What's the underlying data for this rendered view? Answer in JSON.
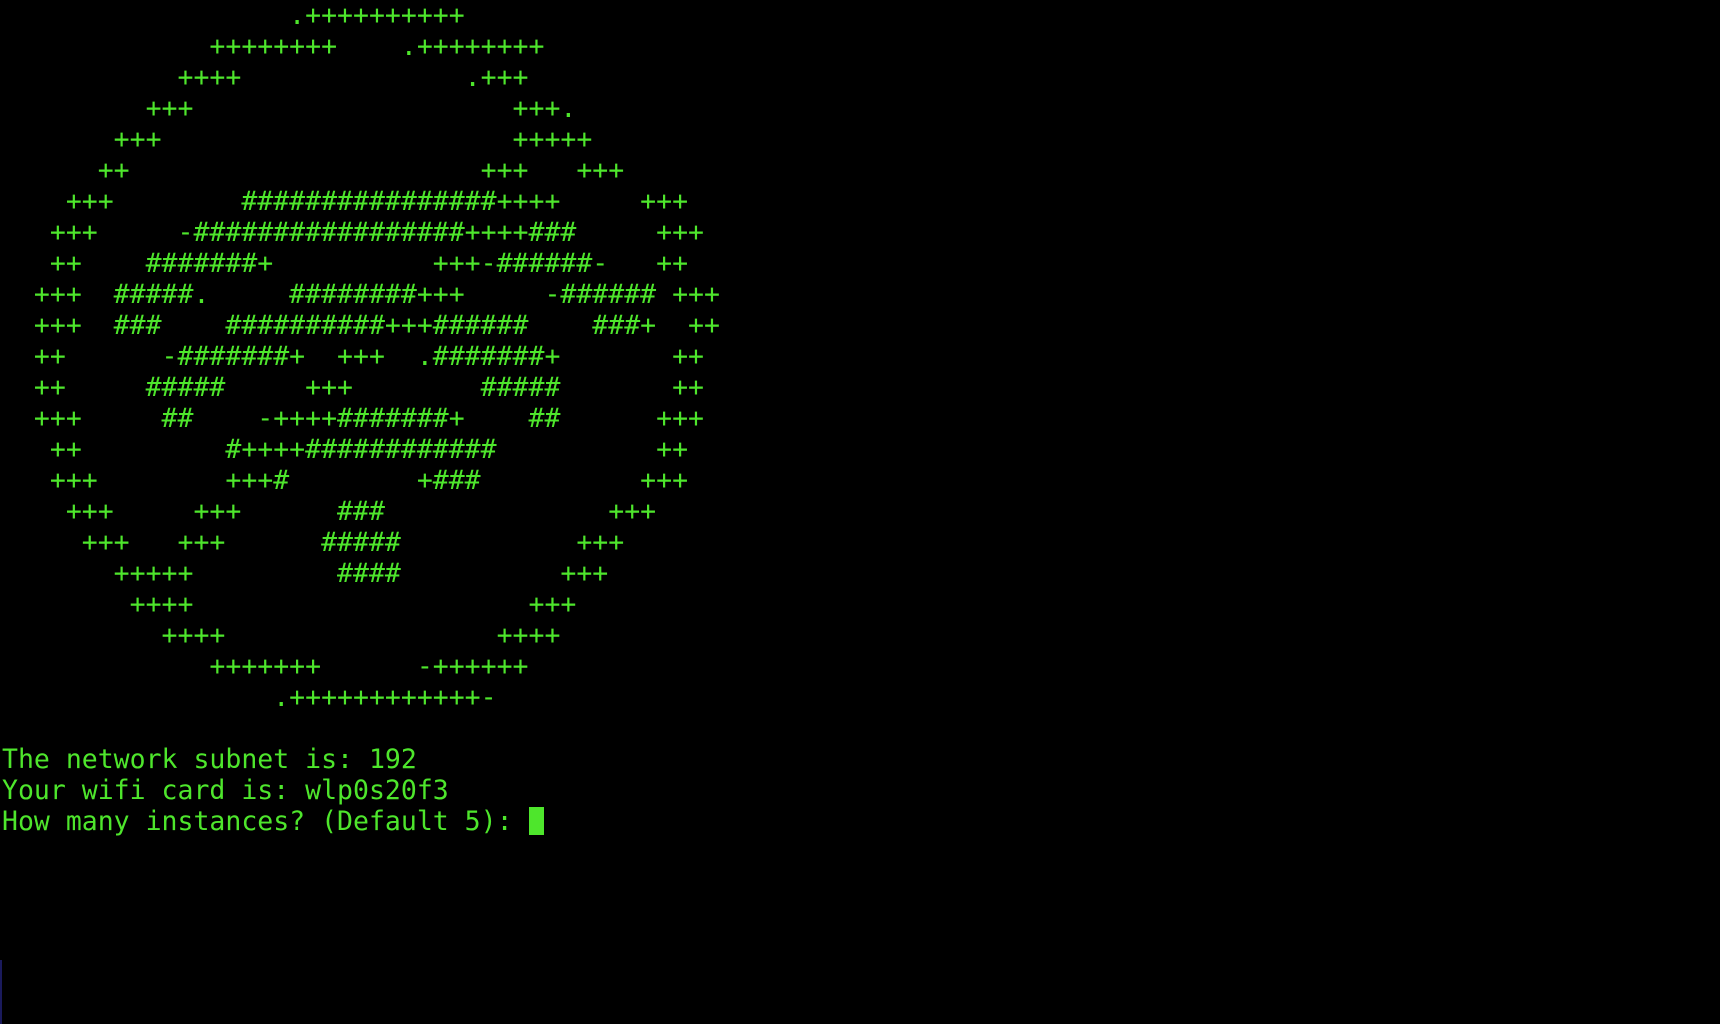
{
  "terminal": {
    "colors": {
      "background": "#000000",
      "foreground": "#4ee62c"
    },
    "ascii_art": [
      "                  .++++++++++",
      "             ++++++++    .++++++++",
      "           ++++              .+++",
      "         +++                    +++.",
      "       +++                      +++++",
      "      ++                      +++   +++",
      "    +++        ################++++     +++",
      "   +++     -#################++++###     +++",
      "   ++    #######+          +++-######-   ++",
      "  +++  #####.     ########+++     -###### +++",
      "  +++  ###    ##########+++######    ###+  ++",
      "  ++      -#######+  +++  .#######+       ++",
      "  ++     #####     +++        #####       ++",
      "  +++     ##    -++++#######+    ##      +++",
      "   ++         #++++############          ++",
      "   +++        +++#        +###          +++",
      "    +++     +++      ###              +++",
      "     +++   +++      #####           +++",
      "       +++++         ####          +++",
      "        ++++                     +++",
      "          ++++                 ++++",
      "             +++++++      -++++++",
      "                 .++++++++++++-"
    ],
    "output_lines": [
      "The network subnet is: 192",
      "Your wifi card is: wlp0s20f3"
    ],
    "prompt": "How many instances? (Default 5): ",
    "input_value": ""
  }
}
